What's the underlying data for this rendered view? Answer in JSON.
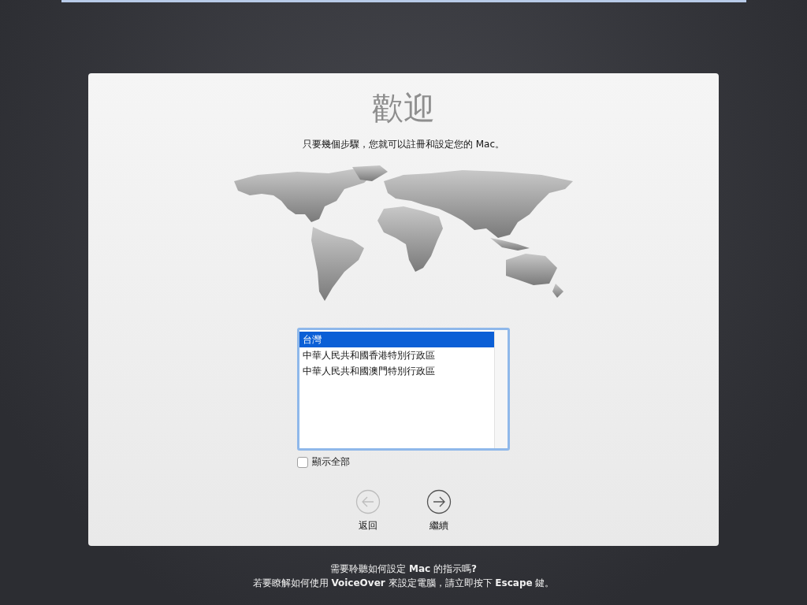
{
  "title": "歡迎",
  "subtitle": "只要幾個步驟，您就可以註冊和設定您的 Mac。",
  "country_list": {
    "items": [
      {
        "label": "台灣",
        "selected": true
      },
      {
        "label": "中華人民共和國香港特別行政區",
        "selected": false
      },
      {
        "label": "中華人民共和國澳門特別行政區",
        "selected": false
      }
    ]
  },
  "show_all": {
    "label": "顯示全部",
    "checked": false
  },
  "buttons": [
    {
      "kind": "back",
      "label": "返回",
      "disabled": true
    },
    {
      "kind": "continue",
      "label": "繼續",
      "disabled": false
    }
  ],
  "footer": [
    "需要聆聽如何設定 **Mac** 的指示嗎**?**",
    "若要瞭解如何使用 **VoiceOver** 來設定電腦，請立即按下 **Escape** 鍵。"
  ]
}
